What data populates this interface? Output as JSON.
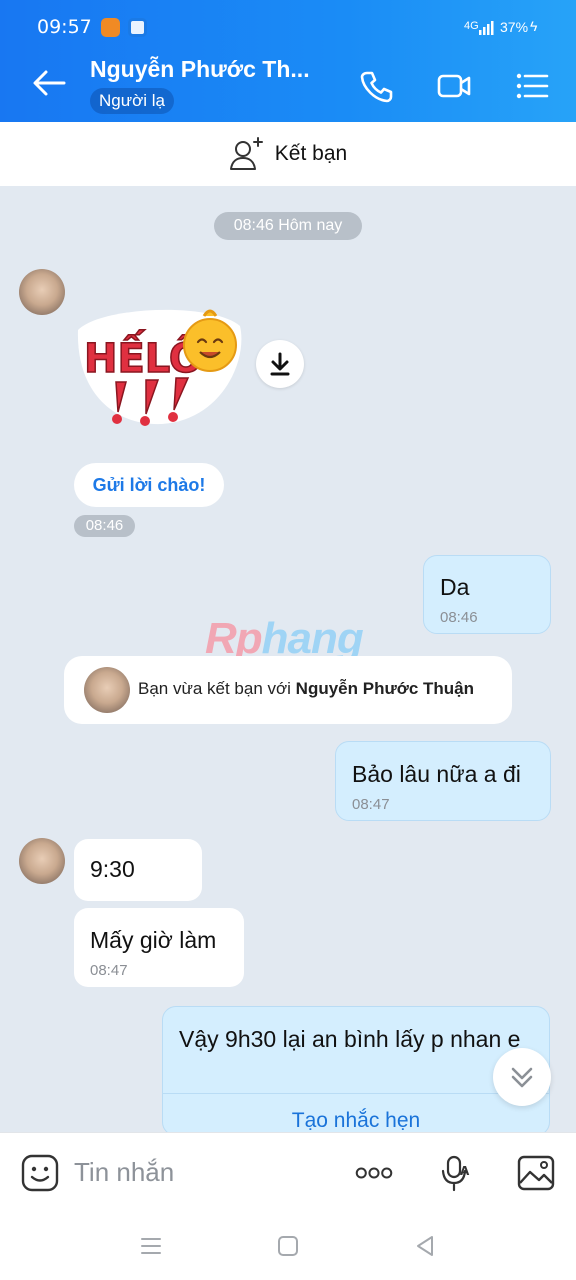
{
  "status_bar": {
    "time": "09:57",
    "network": "4G",
    "battery": "37%"
  },
  "header": {
    "contact_name": "Nguyễn Phước Th...",
    "badge": "Người lạ"
  },
  "add_friend": {
    "label": "Kết bạn"
  },
  "chat": {
    "date_divider": "08:46 Hôm nay",
    "sticker_text": "HẾLÔ",
    "greet_button": "Gửi lời chào!",
    "sticker_time": "08:46",
    "messages": [
      {
        "direction": "out",
        "text": "Da",
        "time": "08:46"
      },
      {
        "direction": "out",
        "text": "Bảo lâu nữa a đi",
        "time": "08:47"
      },
      {
        "direction": "in",
        "text": "9:30",
        "time": ""
      },
      {
        "direction": "in",
        "text": "Mấy giờ làm",
        "time": "08:47"
      },
      {
        "direction": "out",
        "text": "Vậy 9h30 lại an bình lấy p nhan e",
        "time": ""
      }
    ],
    "system": {
      "prefix": "Bạn vừa kết bạn với ",
      "name": "Nguyễn Phước Thuận"
    },
    "reminder_action": "Tạo nhắc hẹn",
    "watermark": {
      "left": "Rp",
      "right": "hang"
    }
  },
  "composer": {
    "placeholder": "Tin nhắn"
  },
  "colors": {
    "header": "#1a8cf6",
    "accent": "#1a73d9",
    "outgoing_bubble": "#d4eefe",
    "background": "#e2e9f1"
  },
  "icons": [
    "back-arrow-icon",
    "phone-icon",
    "video-call-icon",
    "list-menu-icon",
    "add-friend-icon",
    "download-icon",
    "chevron-double-down-icon",
    "emoji-icon",
    "more-icon",
    "voice-icon",
    "image-icon",
    "nav-menu-icon",
    "nav-home-icon",
    "nav-back-icon"
  ]
}
